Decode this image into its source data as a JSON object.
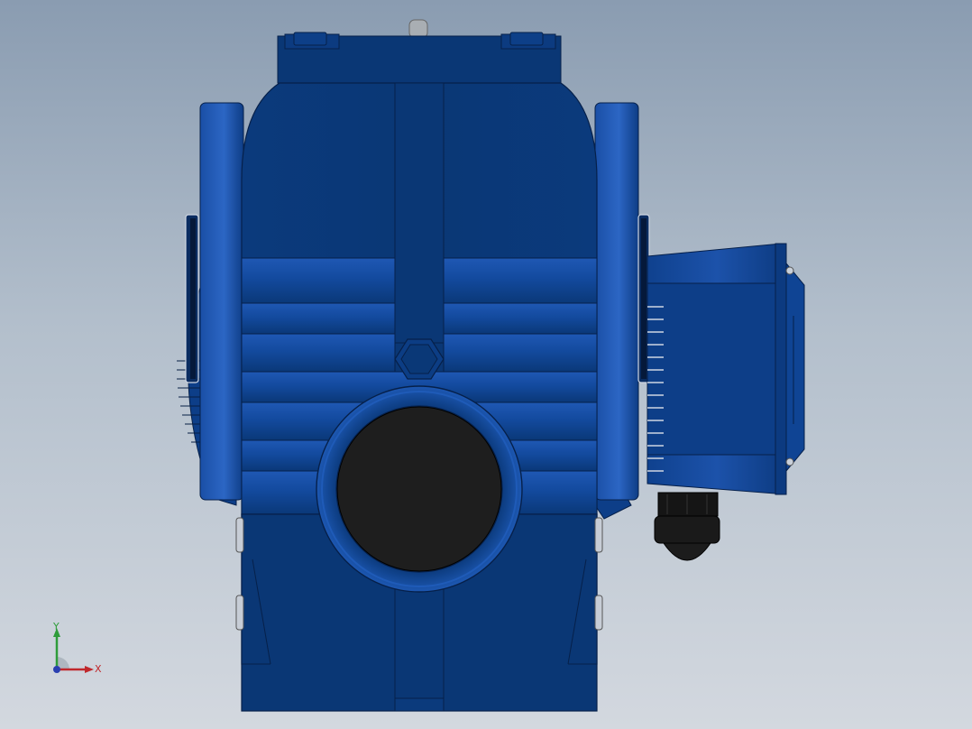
{
  "viewport": {
    "background_top": "#8a9cb1",
    "background_bottom": "#d3d8df"
  },
  "model": {
    "body_color": "#0a3a7a",
    "body_highlight": "#1c57b0",
    "bore_color": "#1e1e1e",
    "icon": "worm-gearbox-motor"
  },
  "triad": {
    "x_label": "X",
    "y_label": "Y",
    "x_color": "#c0282c",
    "y_color": "#2e9c3a",
    "z_color": "#2a3fb0"
  }
}
